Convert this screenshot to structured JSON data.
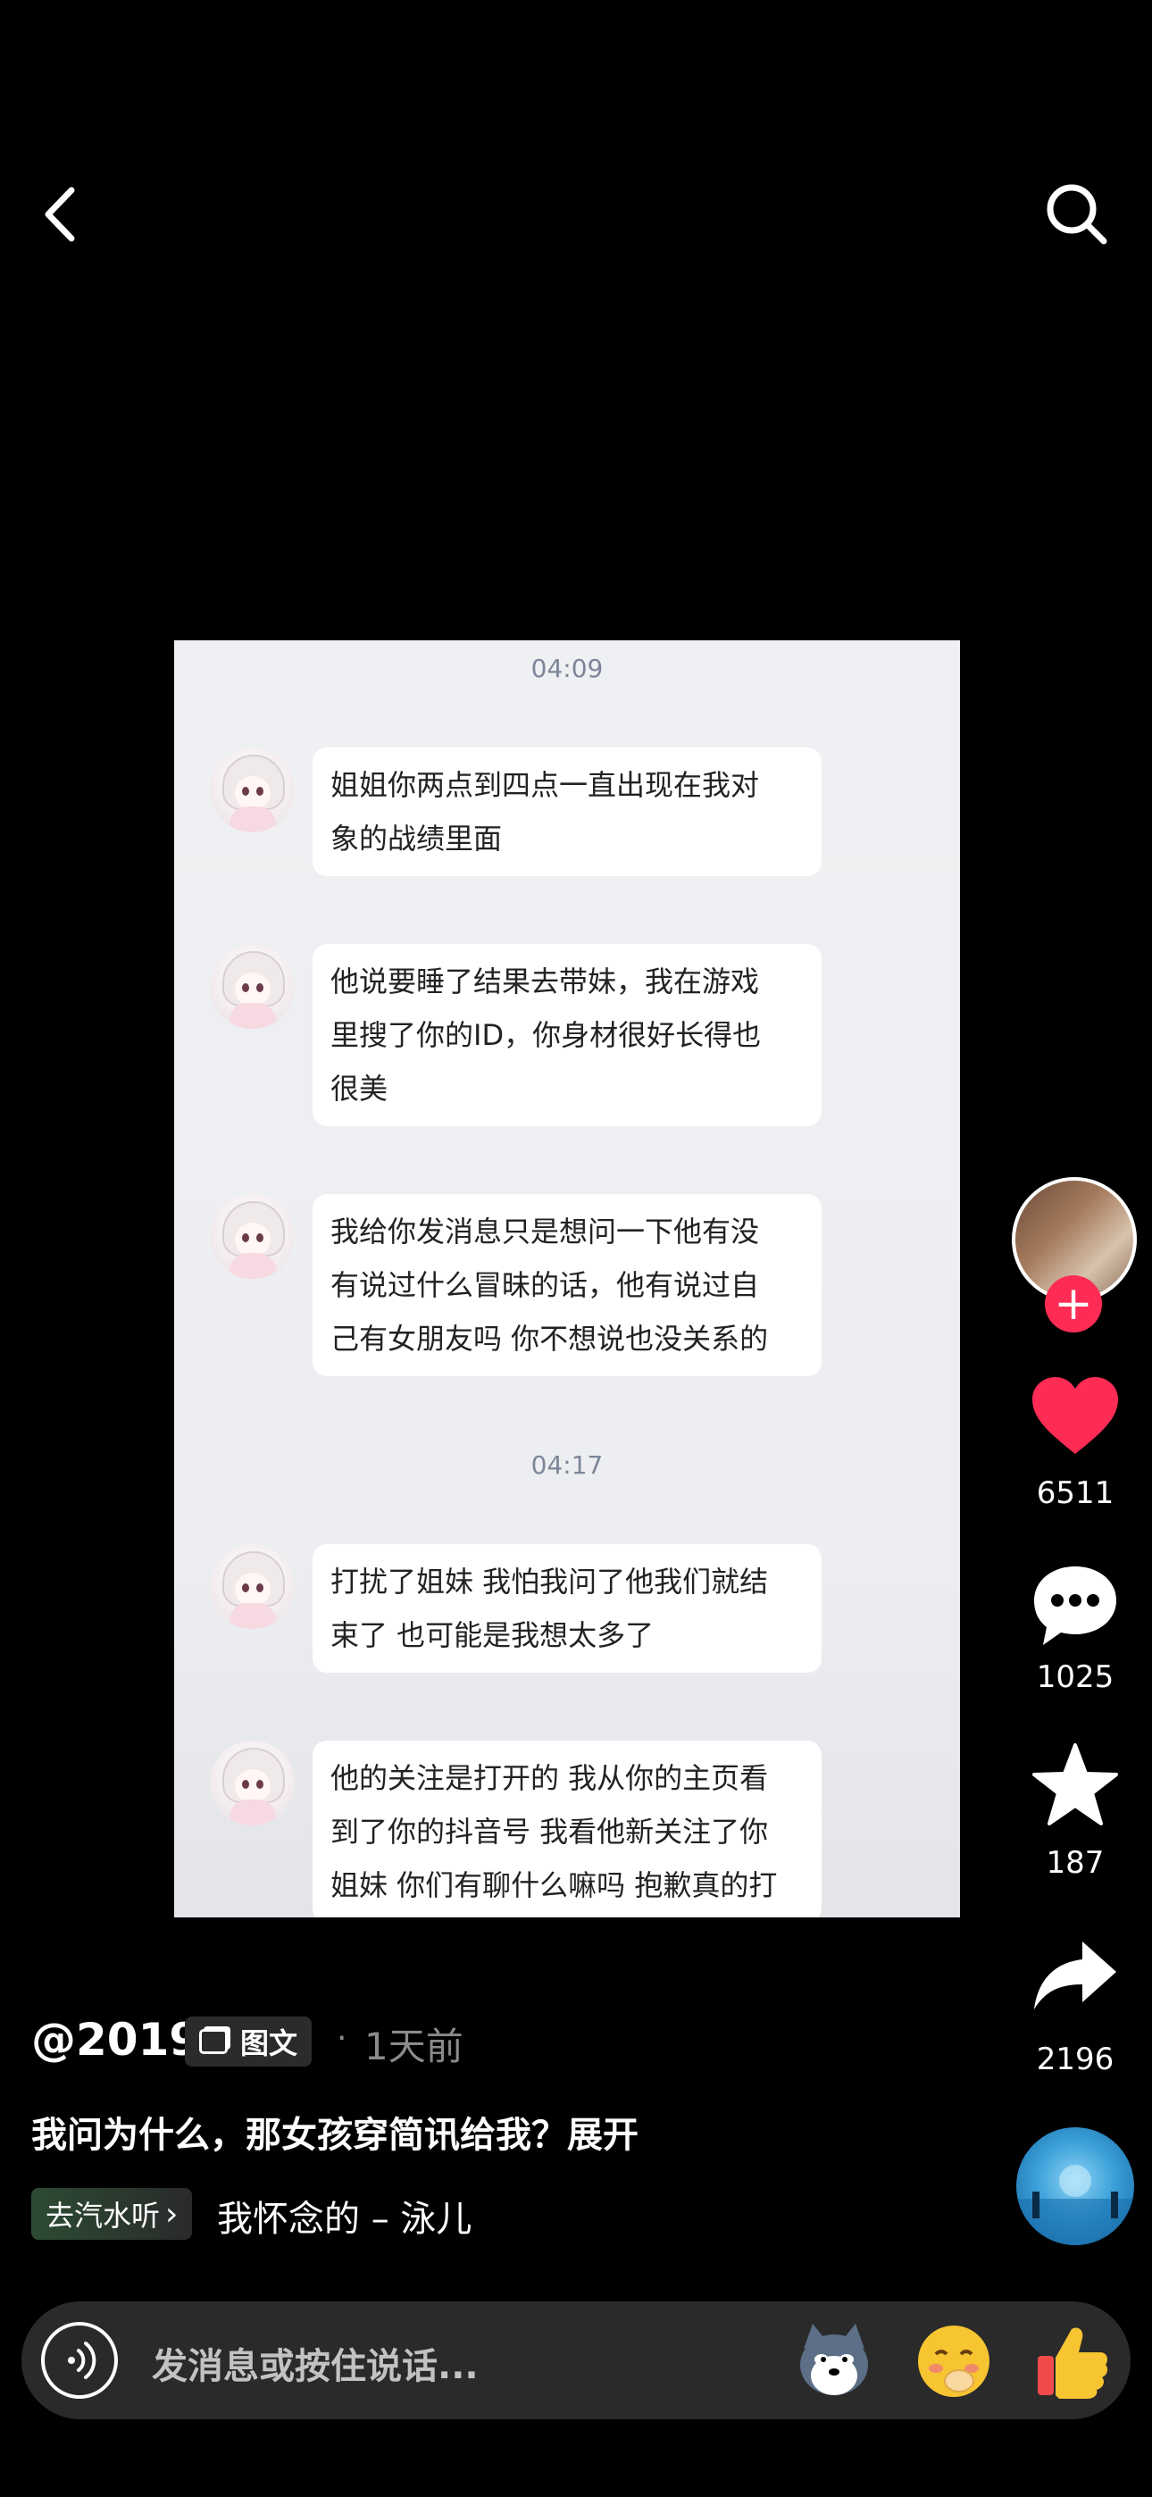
{
  "top_bar": {
    "back_icon": "chevron-left-icon",
    "search_icon": "search-icon"
  },
  "card": {
    "timestamps": [
      "04:09",
      "04:17"
    ],
    "messages": [
      {
        "lines": [
          "姐姐你两点到四点一直出现在我对",
          "象的战绩里面"
        ]
      },
      {
        "lines": [
          "他说要睡了结果去带妹，我在游戏",
          "里搜了你的ID，你身材很好长得也",
          "很美"
        ]
      },
      {
        "lines": [
          "我给你发消息只是想问一下他有没",
          "有说过什么冒昧的话，他有说过自",
          "己有女朋友吗 你不想说也没关系的"
        ]
      },
      {
        "lines": [
          "打扰了姐妹 我怕我问了他我们就结",
          "束了 也可能是我想太多了"
        ]
      },
      {
        "lines": [
          "他的关注是打开的 我从你的主页看",
          "到了你的抖音号 我看他新关注了你",
          "姐妹 你们有聊什么嘛吗 抱歉真的打"
        ]
      }
    ]
  },
  "rail": {
    "follow_label": "+",
    "likes": "6511",
    "comments": "1025",
    "favorites": "187",
    "shares": "2196",
    "colors": {
      "like": "#fe2c55",
      "follow": "#fe2c55"
    }
  },
  "info": {
    "author": "@2019",
    "tag": "图文",
    "dot": "·",
    "time": "1天前",
    "caption": "我问为什么，那女孩穿简讯给我？展开",
    "music_chip": "去汽水听",
    "music_chip_arrow": "›",
    "music_name": "我怀念的 – 泳儿"
  },
  "input": {
    "placeholder": "发消息或按住说话...",
    "icons": [
      "voice-icon",
      "husky-emoji-icon",
      "shy-face-emoji-icon",
      "thumbs-up-emoji-icon"
    ]
  }
}
